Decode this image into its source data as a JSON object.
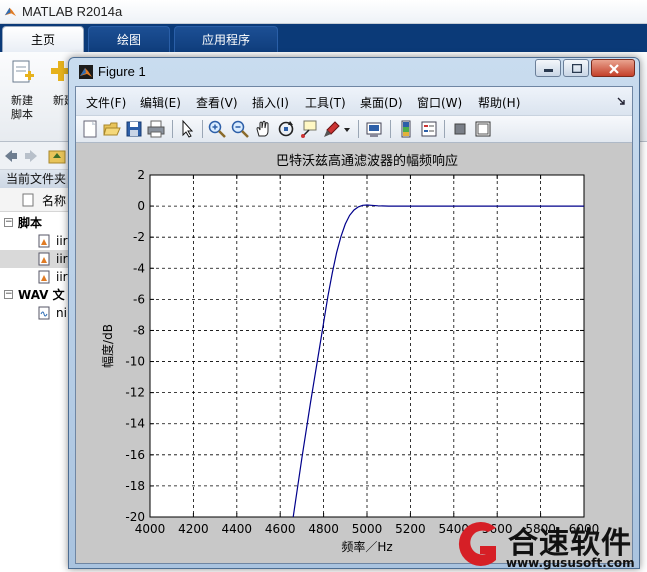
{
  "matlab": {
    "title": "MATLAB R2014a",
    "tabs": [
      "主页",
      "绘图",
      "应用程序"
    ],
    "ribbon": {
      "new_script": [
        "新建",
        "脚本"
      ],
      "new": "新建"
    },
    "current_folder_label": "当前文件夹",
    "name_column": "名称",
    "tree": [
      {
        "type": "group",
        "label": "脚本",
        "expand": "−"
      },
      {
        "type": "file",
        "label": "iir"
      },
      {
        "type": "file",
        "label": "iir",
        "selected": true
      },
      {
        "type": "file",
        "label": "iir"
      },
      {
        "type": "group",
        "label": "WAV 文",
        "expand": "−"
      },
      {
        "type": "wav",
        "label": "ni"
      }
    ]
  },
  "figure": {
    "title": "Figure 1",
    "menu": [
      "文件(F)",
      "编辑(E)",
      "查看(V)",
      "插入(I)",
      "工具(T)",
      "桌面(D)",
      "窗口(W)",
      "帮助(H)"
    ]
  },
  "chart_data": {
    "type": "line",
    "title": "巴特沃兹高通滤波器的幅频响应",
    "xlabel": "频率／Hz",
    "ylabel": "幅度/dB",
    "xlim": [
      4000,
      6000
    ],
    "ylim": [
      -20,
      2
    ],
    "xticks": [
      4000,
      4200,
      4400,
      4600,
      4800,
      5000,
      5200,
      5400,
      5600,
      5800,
      6000
    ],
    "yticks": [
      2,
      0,
      -2,
      -4,
      -6,
      -8,
      -10,
      -12,
      -14,
      -16,
      -18,
      -20
    ],
    "grid": "dashed",
    "series": [
      {
        "color": "#00008b",
        "x": [
          4660,
          4700,
          4740,
          4780,
          4800,
          4820,
          4840,
          4860,
          4880,
          4900,
          4920,
          4940,
          4960,
          4980,
          5000,
          5020,
          5050,
          5100,
          5200,
          5400,
          6000
        ],
        "y": [
          -20,
          -16.2,
          -12.6,
          -9.2,
          -7.5,
          -5.8,
          -4.3,
          -3.0,
          -1.95,
          -1.15,
          -0.6,
          -0.25,
          -0.05,
          0.05,
          0.07,
          0.05,
          0.02,
          0.0,
          0.0,
          0.0,
          0.0
        ]
      }
    ]
  },
  "watermark": {
    "text": "合速软件",
    "url": "www.gususoft.com"
  }
}
